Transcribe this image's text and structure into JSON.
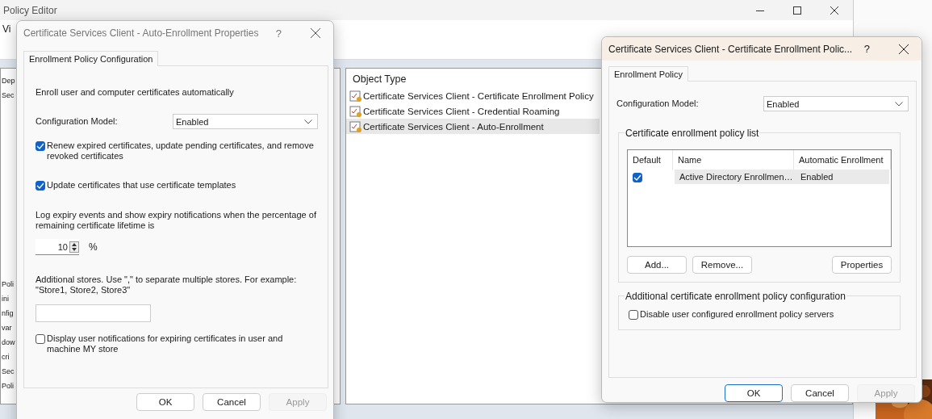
{
  "background_window": {
    "title": "Policy Editor",
    "menu": [
      "Vi"
    ],
    "tree_items": [
      "Dep",
      "Sec",
      "Poli",
      "ini",
      "nfig",
      "var",
      "dow",
      "cri",
      "Sec",
      "Poli"
    ],
    "list": {
      "column": "Object Type",
      "rows": [
        {
          "label": "Certificate Services Client - Certificate Enrollment Policy",
          "selected": false
        },
        {
          "label": "Certificate Services Client - Credential Roaming",
          "selected": false
        },
        {
          "label": "Certificate Services Client - Auto-Enrollment",
          "selected": true
        }
      ]
    }
  },
  "auto_enrollment_dialog": {
    "title": "Certificate Services Client - Auto-Enrollment Properties",
    "help": "?",
    "tabs": [
      {
        "label": "Enrollment Policy Configuration",
        "selected": true
      }
    ],
    "intro": "Enroll user and computer certificates automatically",
    "configuration_model": {
      "label": "Configuration Model:",
      "value": "Enabled"
    },
    "items": [
      {
        "kind": "checkbox",
        "label": "Renew expired certificates, update pending certificates, and remove revoked certificates",
        "checked": true
      },
      {
        "kind": "checkbox",
        "label": "Update certificates that use certificate templates",
        "checked": true
      },
      {
        "kind": "text",
        "label": "Log expiry events and show expiry notifications when the percentage of remaining certificate lifetime is"
      },
      {
        "kind": "spinner",
        "value": "10",
        "unit": "%"
      },
      {
        "kind": "text",
        "label": "Additional stores. Use \",\" to separate multiple stores. For example: \"Store1, Store2, Store3\""
      },
      {
        "kind": "field"
      },
      {
        "kind": "checkbox",
        "label": "Display user notifications for expiring certificates in user and machine MY store",
        "checked": false
      }
    ],
    "buttons": [
      {
        "label": "OK",
        "disabled": false,
        "default": false
      },
      {
        "label": "Cancel",
        "disabled": false,
        "default": false
      },
      {
        "label": "Apply",
        "disabled": true,
        "default": false
      }
    ]
  },
  "enrollment_policy_dialog": {
    "title": "Certificate Services Client - Certificate Enrollment Polic...",
    "help": "?",
    "tabs": [
      {
        "label": "Enrollment Policy",
        "selected": true
      }
    ],
    "configuration_model": {
      "label": "Configuration Model:",
      "value": "Enabled"
    },
    "policy_list": {
      "legend": "Certificate enrollment policy list",
      "columns": [
        "Default",
        "Name",
        "Automatic Enrollment"
      ],
      "rows": [
        {
          "default": true,
          "name": "Active Directory Enrollmen…",
          "automatic_enrollment": "Enabled",
          "selected": true
        }
      ],
      "buttons": [
        "Add...",
        "Remove...",
        "Properties"
      ]
    },
    "additional": {
      "legend": "Additional certificate enrollment policy configuration",
      "options": [
        {
          "label": "Disable user configured enrollment policy servers",
          "checked": false
        }
      ]
    },
    "buttons": [
      {
        "label": "OK",
        "disabled": false,
        "default": true
      },
      {
        "label": "Cancel",
        "disabled": false,
        "default": false
      },
      {
        "label": "Apply",
        "disabled": true,
        "default": false
      }
    ]
  }
}
